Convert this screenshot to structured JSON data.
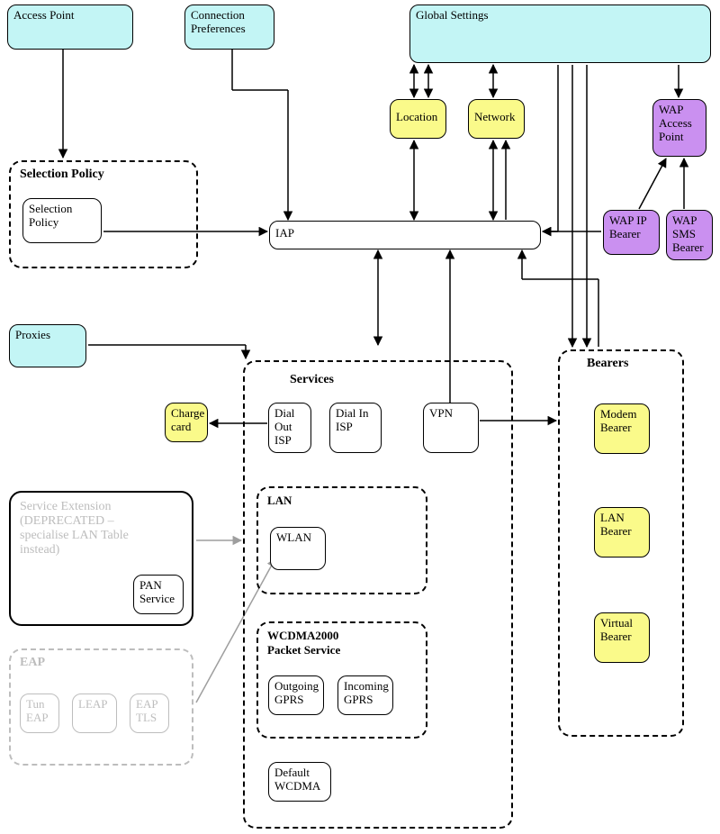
{
  "top": {
    "access_point": "Access Point",
    "connection_prefs": "Connection\nPreferences",
    "global_settings": "Global Settings"
  },
  "row2": {
    "location": "Location",
    "network": "Network",
    "wap_access_point": "WAP\nAccess\nPoint"
  },
  "selection_policy": {
    "group": "Selection Policy",
    "item": "Selection\nPolicy"
  },
  "iap": "IAP",
  "wap_ip": "WAP IP\nBearer",
  "wap_sms": "WAP\nSMS\nBearer",
  "proxies": "Proxies",
  "charge_card": "Charge\ncard",
  "services": {
    "group": "Services",
    "dial_out": "Dial\nOut\nISP",
    "dial_in": "Dial In\nISP",
    "vpn": "VPN",
    "lan_group": "LAN",
    "wlan": "WLAN",
    "wcdma_group": "WCDMA2000\nPacket Service",
    "out_gprs": "Outgoing\nGPRS",
    "in_gprs": "Incoming\nGPRS",
    "default_wcdma": "Default\nWCDMA"
  },
  "bearers": {
    "group": "Bearers",
    "modem": "Modem\nBearer",
    "lan": "LAN\nBearer",
    "virtual": "Virtual\nBearer"
  },
  "svc_ext": {
    "title": "Service Extension\n(DEPRECATED –\nspecialise LAN Table\ninstead)",
    "pan": "PAN\nService"
  },
  "eap": {
    "group": "EAP",
    "tun": "Tun\nEAP",
    "leap": "LEAP",
    "tls": "EAP\nTLS"
  }
}
